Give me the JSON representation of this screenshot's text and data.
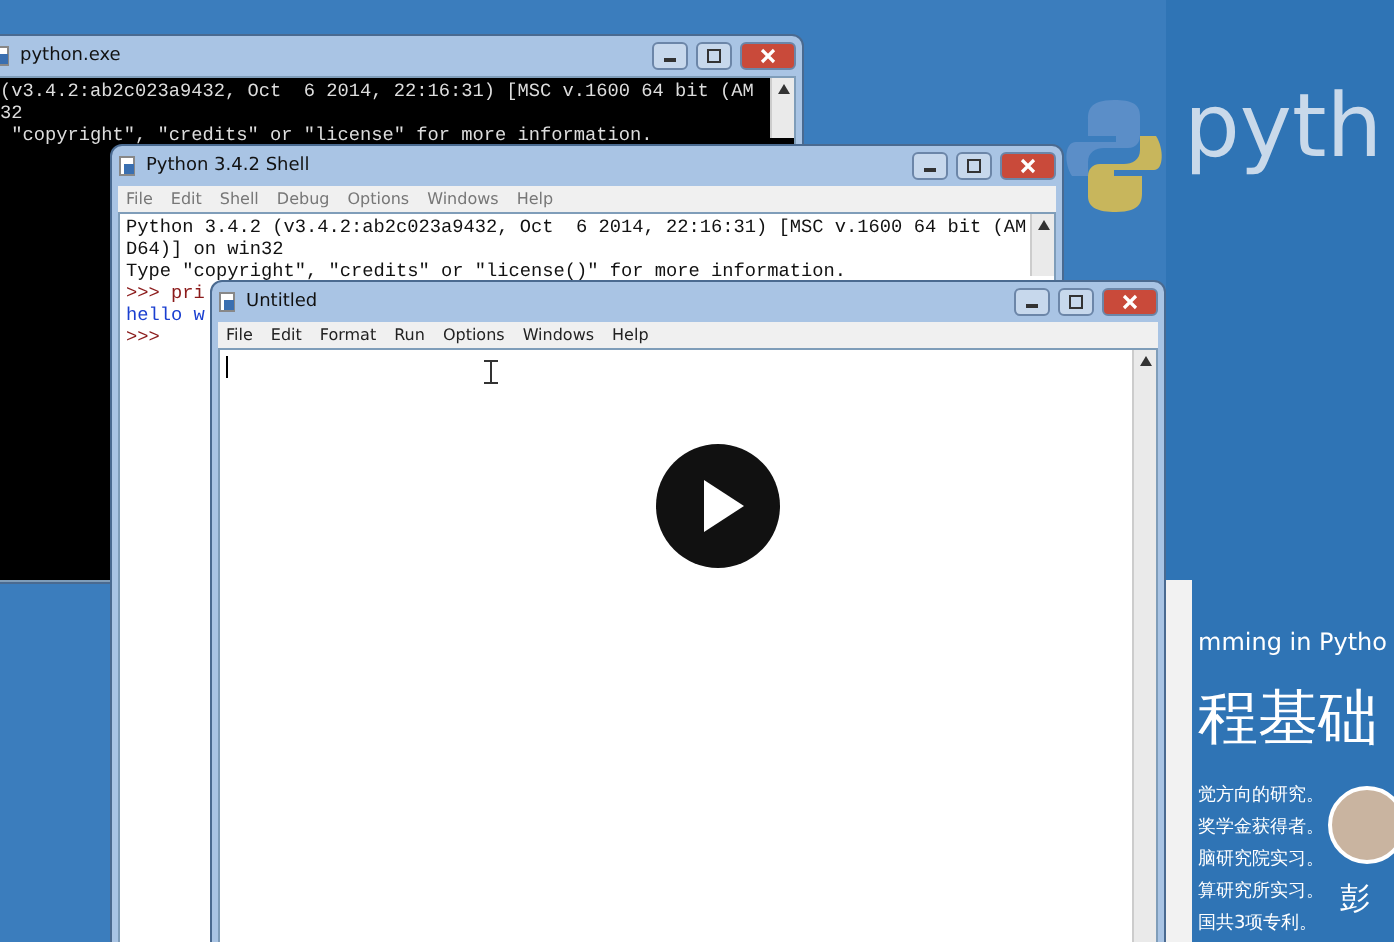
{
  "slide": {
    "logo_text": "pyth",
    "subtitle": "mming in Pytho",
    "heading": "程基础",
    "bullets": [
      "觉方向的研究。",
      "奖学金获得者。",
      "脑研究院实习。",
      "算研究所实习。",
      "国共3项专利。"
    ],
    "presenter": "彭"
  },
  "windows": [
    {
      "kind": "console",
      "title": "python.exe",
      "lines": [
        {
          "text": "(v3.4.2:ab2c023a9432, Oct  6 2014, 22:16:31) [MSC v.1600 64 bit (AM",
          "kind": "output"
        },
        {
          "text": "32",
          "kind": "output"
        },
        {
          "text": " \"copyright\", \"credits\" or \"license\" for more information.",
          "kind": "output"
        }
      ]
    },
    {
      "kind": "shell",
      "title": "Python 3.4.2 Shell",
      "menu": [
        "File",
        "Edit",
        "Shell",
        "Debug",
        "Options",
        "Windows",
        "Help"
      ],
      "lines": [
        {
          "text": "Python 3.4.2 (v3.4.2:ab2c023a9432, Oct  6 2014, 22:16:31) [MSC v.1600 64 bit (AM",
          "kind": "output"
        },
        {
          "text": "D64)] on win32",
          "kind": "output"
        },
        {
          "text": "Type \"copyright\", \"credits\" or \"license()\" for more information.",
          "kind": "output"
        },
        {
          "text": ">>> pri",
          "kind": "prompt"
        },
        {
          "text": "hello w",
          "kind": "result"
        },
        {
          "text": ">>>",
          "kind": "prompt"
        }
      ]
    },
    {
      "kind": "editor",
      "title": "Untitled",
      "menu": [
        "File",
        "Edit",
        "Format",
        "Run",
        "Options",
        "Windows",
        "Help"
      ]
    }
  ]
}
